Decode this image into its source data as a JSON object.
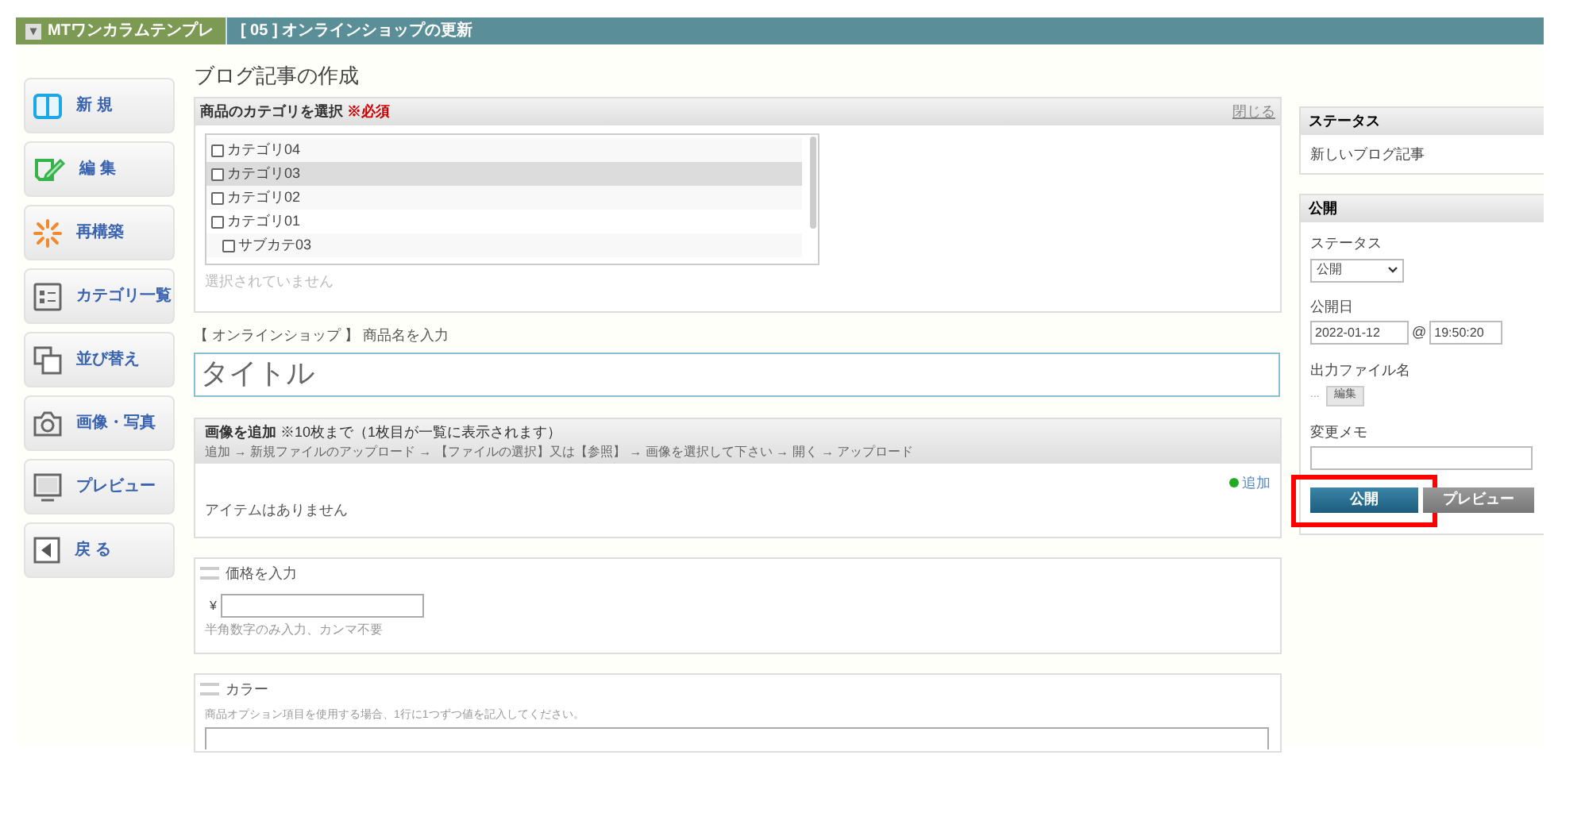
{
  "breadcrumb": {
    "menu_icon": "▾",
    "site": "MTワンカラムテンプレ",
    "page": "[ 05 ] オンラインショップの更新"
  },
  "sidebar": {
    "items": [
      {
        "label": "新 規"
      },
      {
        "label": "編 集"
      },
      {
        "label": "再構築"
      },
      {
        "label": "カテゴリ一覧"
      },
      {
        "label": "並び替え"
      },
      {
        "label": "画像・写真"
      },
      {
        "label": "プレビュー"
      },
      {
        "label": "戻 る"
      }
    ]
  },
  "page_title": "ブログ記事の作成",
  "category_panel": {
    "title": "商品のカテゴリを選択",
    "required": "※必須",
    "close_link": "閉じる",
    "items": [
      {
        "label": "カテゴリ04",
        "checked": false,
        "selected": false
      },
      {
        "label": "カテゴリ03",
        "checked": false,
        "selected": true
      },
      {
        "label": "カテゴリ02",
        "checked": false,
        "selected": false
      },
      {
        "label": "カテゴリ01",
        "checked": false,
        "selected": false,
        "children": [
          {
            "label": "サブカテ03",
            "checked": false,
            "selected": false
          }
        ]
      }
    ],
    "empty_note": "選択されていません"
  },
  "title_field": {
    "label": "【 オンラインショップ 】 商品名を入力",
    "placeholder": "タイトル"
  },
  "image_panel": {
    "title": "画像を追加",
    "title_note": "※10枚まで（1枚目が一覧に表示されます）",
    "instructions": "追加 → 新規ファイルのアップロード → 【ファイルの選択】又は【参照】 → 画像を選択して下さい → 開く → アップロード",
    "add_link": "追加",
    "empty": "アイテムはありません"
  },
  "price_panel": {
    "title": "価格を入力",
    "currency": "¥",
    "hint": "半角数字のみ入力、カンマ不要"
  },
  "color_panel": {
    "title": "カラー",
    "hint": "商品オプション項目を使用する場合、1行に1つずつ値を記入してください。"
  },
  "status_panel": {
    "title": "ステータス",
    "value": "新しいブログ記事"
  },
  "publish_panel": {
    "title": "公開",
    "status_label": "ステータス",
    "status_value": "公開",
    "date_label": "公開日",
    "date": "2022-01-12",
    "at": "@",
    "time": "19:50:20",
    "file_label": "出力ファイル名",
    "file_value": "...",
    "file_edit": "編集",
    "memo_label": "変更メモ",
    "buttons": [
      {
        "label": "公開",
        "kind": "primary",
        "highlighted": true
      },
      {
        "label": "プレビュー",
        "kind": "secondary",
        "highlighted": false
      }
    ]
  }
}
